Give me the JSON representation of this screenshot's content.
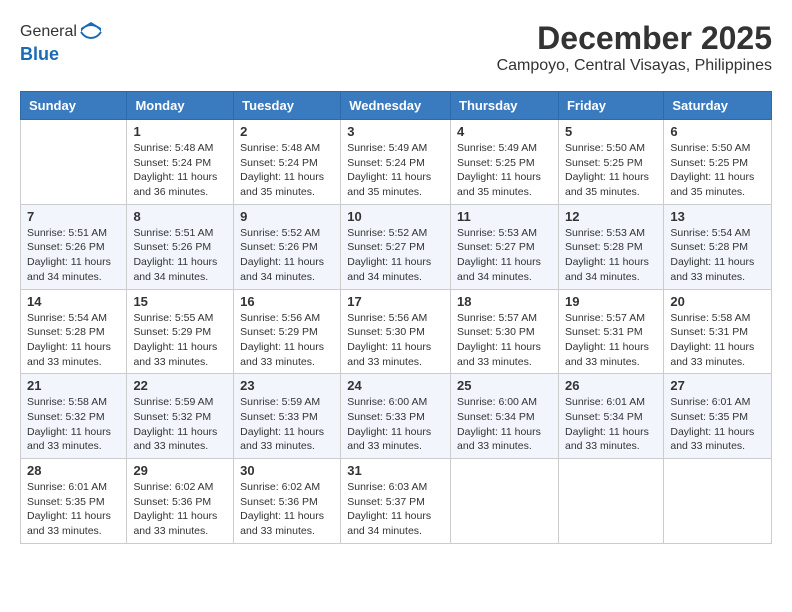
{
  "logo": {
    "general": "General",
    "blue": "Blue"
  },
  "header": {
    "month": "December 2025",
    "location": "Campoyo, Central Visayas, Philippines"
  },
  "weekdays": [
    "Sunday",
    "Monday",
    "Tuesday",
    "Wednesday",
    "Thursday",
    "Friday",
    "Saturday"
  ],
  "weeks": [
    [
      {
        "day": "",
        "sunrise": "",
        "sunset": "",
        "daylight": ""
      },
      {
        "day": "1",
        "sunrise": "Sunrise: 5:48 AM",
        "sunset": "Sunset: 5:24 PM",
        "daylight": "Daylight: 11 hours and 36 minutes."
      },
      {
        "day": "2",
        "sunrise": "Sunrise: 5:48 AM",
        "sunset": "Sunset: 5:24 PM",
        "daylight": "Daylight: 11 hours and 35 minutes."
      },
      {
        "day": "3",
        "sunrise": "Sunrise: 5:49 AM",
        "sunset": "Sunset: 5:24 PM",
        "daylight": "Daylight: 11 hours and 35 minutes."
      },
      {
        "day": "4",
        "sunrise": "Sunrise: 5:49 AM",
        "sunset": "Sunset: 5:25 PM",
        "daylight": "Daylight: 11 hours and 35 minutes."
      },
      {
        "day": "5",
        "sunrise": "Sunrise: 5:50 AM",
        "sunset": "Sunset: 5:25 PM",
        "daylight": "Daylight: 11 hours and 35 minutes."
      },
      {
        "day": "6",
        "sunrise": "Sunrise: 5:50 AM",
        "sunset": "Sunset: 5:25 PM",
        "daylight": "Daylight: 11 hours and 35 minutes."
      }
    ],
    [
      {
        "day": "7",
        "sunrise": "Sunrise: 5:51 AM",
        "sunset": "Sunset: 5:26 PM",
        "daylight": "Daylight: 11 hours and 34 minutes."
      },
      {
        "day": "8",
        "sunrise": "Sunrise: 5:51 AM",
        "sunset": "Sunset: 5:26 PM",
        "daylight": "Daylight: 11 hours and 34 minutes."
      },
      {
        "day": "9",
        "sunrise": "Sunrise: 5:52 AM",
        "sunset": "Sunset: 5:26 PM",
        "daylight": "Daylight: 11 hours and 34 minutes."
      },
      {
        "day": "10",
        "sunrise": "Sunrise: 5:52 AM",
        "sunset": "Sunset: 5:27 PM",
        "daylight": "Daylight: 11 hours and 34 minutes."
      },
      {
        "day": "11",
        "sunrise": "Sunrise: 5:53 AM",
        "sunset": "Sunset: 5:27 PM",
        "daylight": "Daylight: 11 hours and 34 minutes."
      },
      {
        "day": "12",
        "sunrise": "Sunrise: 5:53 AM",
        "sunset": "Sunset: 5:28 PM",
        "daylight": "Daylight: 11 hours and 34 minutes."
      },
      {
        "day": "13",
        "sunrise": "Sunrise: 5:54 AM",
        "sunset": "Sunset: 5:28 PM",
        "daylight": "Daylight: 11 hours and 33 minutes."
      }
    ],
    [
      {
        "day": "14",
        "sunrise": "Sunrise: 5:54 AM",
        "sunset": "Sunset: 5:28 PM",
        "daylight": "Daylight: 11 hours and 33 minutes."
      },
      {
        "day": "15",
        "sunrise": "Sunrise: 5:55 AM",
        "sunset": "Sunset: 5:29 PM",
        "daylight": "Daylight: 11 hours and 33 minutes."
      },
      {
        "day": "16",
        "sunrise": "Sunrise: 5:56 AM",
        "sunset": "Sunset: 5:29 PM",
        "daylight": "Daylight: 11 hours and 33 minutes."
      },
      {
        "day": "17",
        "sunrise": "Sunrise: 5:56 AM",
        "sunset": "Sunset: 5:30 PM",
        "daylight": "Daylight: 11 hours and 33 minutes."
      },
      {
        "day": "18",
        "sunrise": "Sunrise: 5:57 AM",
        "sunset": "Sunset: 5:30 PM",
        "daylight": "Daylight: 11 hours and 33 minutes."
      },
      {
        "day": "19",
        "sunrise": "Sunrise: 5:57 AM",
        "sunset": "Sunset: 5:31 PM",
        "daylight": "Daylight: 11 hours and 33 minutes."
      },
      {
        "day": "20",
        "sunrise": "Sunrise: 5:58 AM",
        "sunset": "Sunset: 5:31 PM",
        "daylight": "Daylight: 11 hours and 33 minutes."
      }
    ],
    [
      {
        "day": "21",
        "sunrise": "Sunrise: 5:58 AM",
        "sunset": "Sunset: 5:32 PM",
        "daylight": "Daylight: 11 hours and 33 minutes."
      },
      {
        "day": "22",
        "sunrise": "Sunrise: 5:59 AM",
        "sunset": "Sunset: 5:32 PM",
        "daylight": "Daylight: 11 hours and 33 minutes."
      },
      {
        "day": "23",
        "sunrise": "Sunrise: 5:59 AM",
        "sunset": "Sunset: 5:33 PM",
        "daylight": "Daylight: 11 hours and 33 minutes."
      },
      {
        "day": "24",
        "sunrise": "Sunrise: 6:00 AM",
        "sunset": "Sunset: 5:33 PM",
        "daylight": "Daylight: 11 hours and 33 minutes."
      },
      {
        "day": "25",
        "sunrise": "Sunrise: 6:00 AM",
        "sunset": "Sunset: 5:34 PM",
        "daylight": "Daylight: 11 hours and 33 minutes."
      },
      {
        "day": "26",
        "sunrise": "Sunrise: 6:01 AM",
        "sunset": "Sunset: 5:34 PM",
        "daylight": "Daylight: 11 hours and 33 minutes."
      },
      {
        "day": "27",
        "sunrise": "Sunrise: 6:01 AM",
        "sunset": "Sunset: 5:35 PM",
        "daylight": "Daylight: 11 hours and 33 minutes."
      }
    ],
    [
      {
        "day": "28",
        "sunrise": "Sunrise: 6:01 AM",
        "sunset": "Sunset: 5:35 PM",
        "daylight": "Daylight: 11 hours and 33 minutes."
      },
      {
        "day": "29",
        "sunrise": "Sunrise: 6:02 AM",
        "sunset": "Sunset: 5:36 PM",
        "daylight": "Daylight: 11 hours and 33 minutes."
      },
      {
        "day": "30",
        "sunrise": "Sunrise: 6:02 AM",
        "sunset": "Sunset: 5:36 PM",
        "daylight": "Daylight: 11 hours and 33 minutes."
      },
      {
        "day": "31",
        "sunrise": "Sunrise: 6:03 AM",
        "sunset": "Sunset: 5:37 PM",
        "daylight": "Daylight: 11 hours and 34 minutes."
      },
      {
        "day": "",
        "sunrise": "",
        "sunset": "",
        "daylight": ""
      },
      {
        "day": "",
        "sunrise": "",
        "sunset": "",
        "daylight": ""
      },
      {
        "day": "",
        "sunrise": "",
        "sunset": "",
        "daylight": ""
      }
    ]
  ]
}
